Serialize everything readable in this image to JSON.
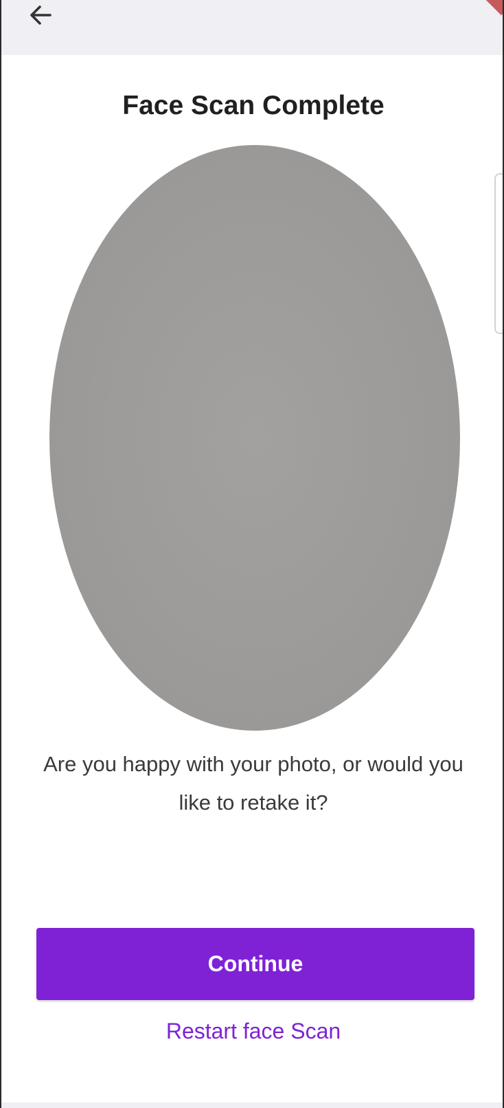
{
  "header": {
    "back_icon": "arrow-left-icon"
  },
  "main": {
    "title": "Face Scan Complete",
    "prompt": "Are you happy with your photo, or would you like to retake it?",
    "continue_label": "Continue",
    "restart_label": "Restart face Scan"
  },
  "colors": {
    "accent": "#7f22d6",
    "header_bg": "#efeff4",
    "photo_placeholder": "#9d9b99"
  }
}
